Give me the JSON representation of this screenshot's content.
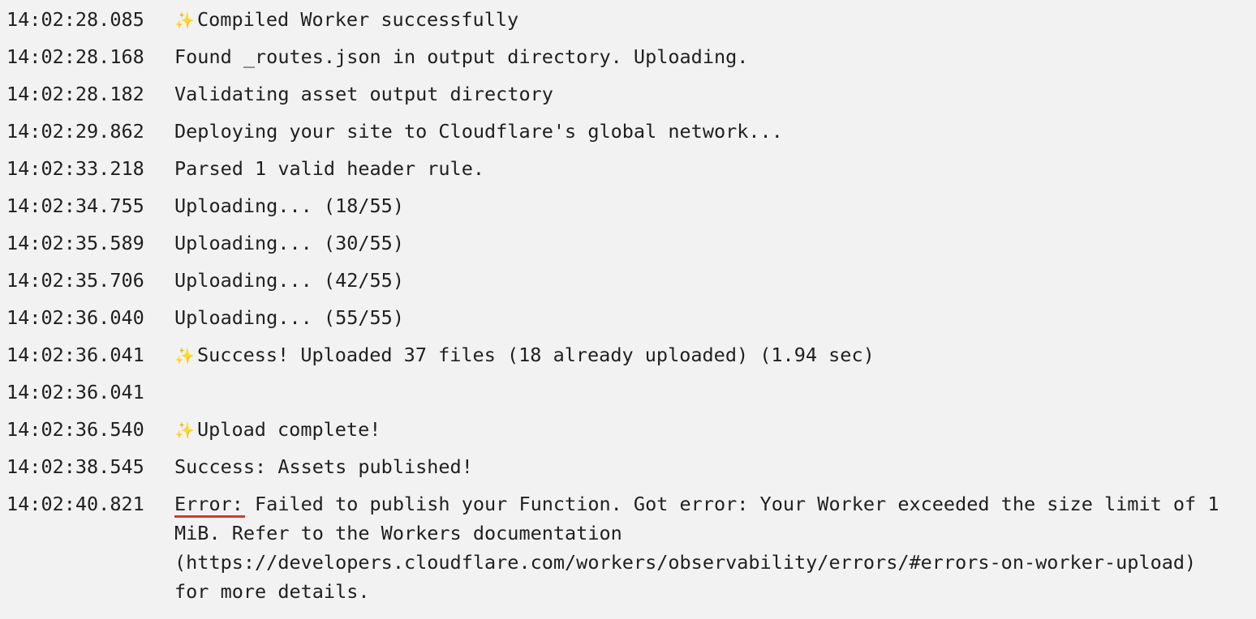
{
  "log": {
    "entries": [
      {
        "time": "14:02:28.085",
        "icon": "sparkles-icon",
        "text": "Compiled Worker successfully"
      },
      {
        "time": "14:02:28.168",
        "icon": "",
        "text": "Found _routes.json in output directory. Uploading."
      },
      {
        "time": "14:02:28.182",
        "icon": "",
        "text": "Validating asset output directory"
      },
      {
        "time": "14:02:29.862",
        "icon": "",
        "text": "Deploying your site to Cloudflare's global network..."
      },
      {
        "time": "14:02:33.218",
        "icon": "",
        "text": "Parsed 1 valid header rule."
      },
      {
        "time": "14:02:34.755",
        "icon": "",
        "text": "Uploading... (18/55)"
      },
      {
        "time": "14:02:35.589",
        "icon": "",
        "text": "Uploading... (30/55)"
      },
      {
        "time": "14:02:35.706",
        "icon": "",
        "text": "Uploading... (42/55)"
      },
      {
        "time": "14:02:36.040",
        "icon": "",
        "text": "Uploading... (55/55)"
      },
      {
        "time": "14:02:36.041",
        "icon": "sparkles-icon",
        "text": "Success! Uploaded 37 files (18 already uploaded) (1.94 sec)"
      },
      {
        "time": "14:02:36.041",
        "icon": "",
        "text": ""
      },
      {
        "time": "14:02:36.540",
        "icon": "sparkles-icon",
        "text": "Upload complete!"
      },
      {
        "time": "14:02:38.545",
        "icon": "",
        "text": "Success: Assets published!"
      }
    ],
    "error": {
      "time": "14:02:40.821",
      "label": "Error:",
      "line1": " Failed to publish your Function. Got error: Your Worker exceeded the size limit of 1",
      "line2": "MiB. Refer to the Workers documentation",
      "line3": "(https://developers.cloudflare.com/workers/observability/errors/#errors-on-worker-upload)",
      "line4": "for more details."
    },
    "sparkle_glyph": "✨",
    "colors": {
      "background": "#f2f2f2",
      "text": "#1f1f1f",
      "error_underline": "#d33a2c",
      "sparkle": "#f0c14b"
    }
  }
}
